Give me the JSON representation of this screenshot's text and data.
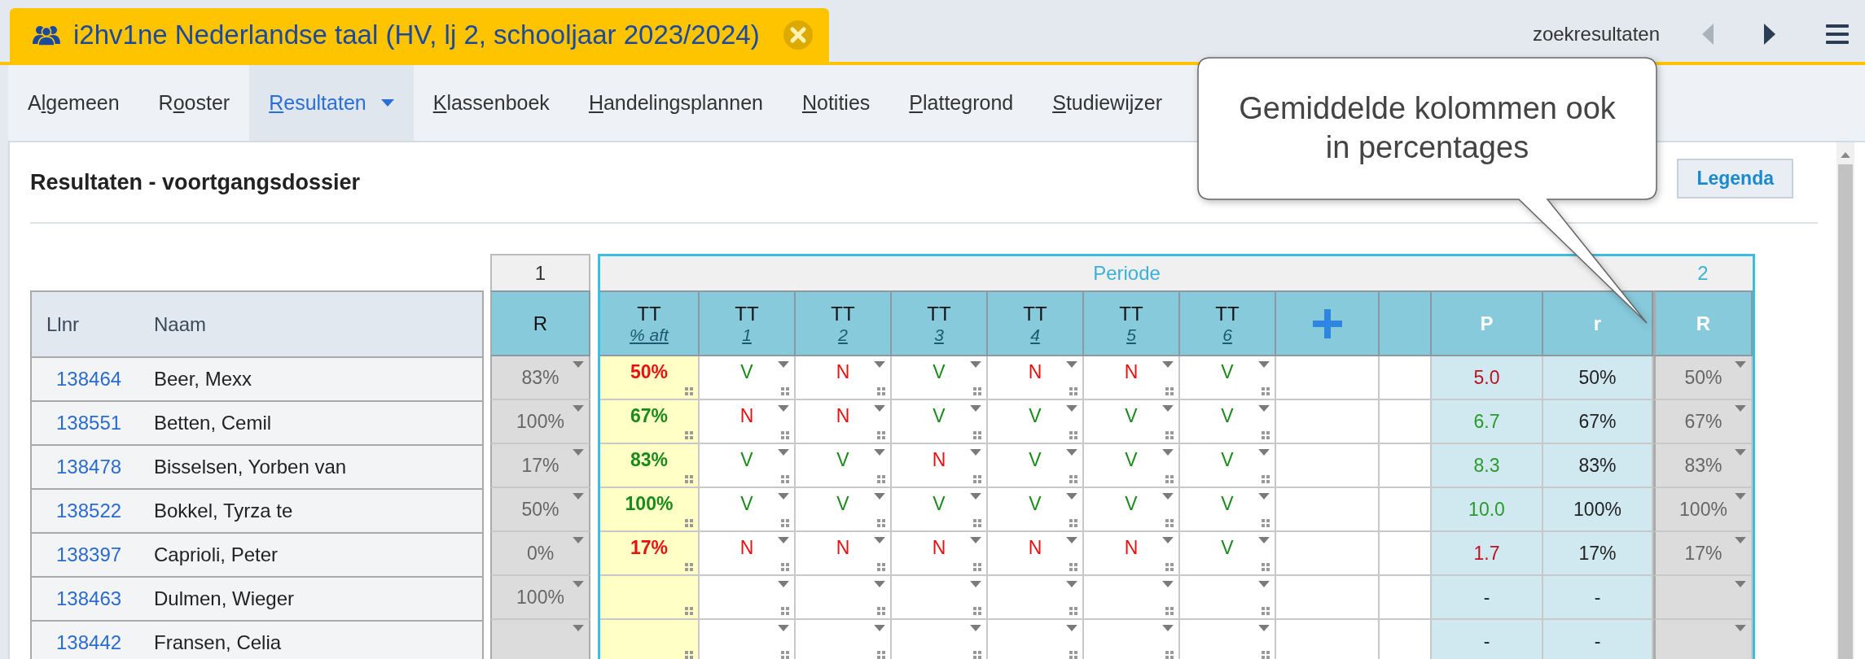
{
  "class_tab": {
    "title": "i2hv1ne Nederlandse taal (HV, lj 2, schooljaar 2023/2024)"
  },
  "search_nav": {
    "label": "zoekresultaten",
    "previous_disabled": true,
    "next_disabled": false
  },
  "nav_tabs": [
    {
      "label": {
        "before": "A",
        "key": "l",
        "after": "gemeen"
      },
      "selected": false,
      "has_menu": false
    },
    {
      "label": {
        "before": "R",
        "key": "o",
        "after": "oster"
      },
      "selected": false,
      "has_menu": false
    },
    {
      "label": {
        "key": "R",
        "after": "esultaten"
      },
      "selected": true,
      "has_menu": true
    },
    {
      "label": {
        "key": "K",
        "after": "lassenboek"
      },
      "selected": false,
      "has_menu": false
    },
    {
      "label": {
        "key": "H",
        "after": "andelingsplannen"
      },
      "selected": false,
      "has_menu": false
    },
    {
      "label": {
        "key": "N",
        "after": "otities"
      },
      "selected": false,
      "has_menu": false
    },
    {
      "label": {
        "key": "P",
        "after": "lattegrond"
      },
      "selected": false,
      "has_menu": false
    },
    {
      "label": {
        "key": "S",
        "after": "tudiewijzer"
      },
      "selected": false,
      "has_menu": false
    }
  ],
  "page_title": "Resultaten - voortgangsdossier",
  "legend_button": "Legenda",
  "callout": "Gemiddelde kolommen ook in percentages",
  "table": {
    "student_columns": [
      "Llnr",
      "Naam"
    ],
    "period1": {
      "number": "1",
      "column": "R"
    },
    "period": {
      "label": "Periode",
      "test_columns": [
        {
          "kind": "percentage",
          "type": "TT",
          "link": "% aft"
        },
        {
          "kind": "test",
          "type": "TT",
          "link": "1"
        },
        {
          "kind": "test",
          "type": "TT",
          "link": "2"
        },
        {
          "kind": "test",
          "type": "TT",
          "link": "3"
        },
        {
          "kind": "test",
          "type": "TT",
          "link": "4"
        },
        {
          "kind": "test",
          "type": "TT",
          "link": "5"
        },
        {
          "kind": "test",
          "type": "TT",
          "link": "6"
        }
      ],
      "average_columns": [
        "P",
        "r"
      ]
    },
    "period2": {
      "number": "2",
      "column": "R"
    },
    "rows": [
      {
        "llnr": "138464",
        "name": "Beer, Mexx",
        "r1": "83%",
        "pct": "50%",
        "passed": false,
        "marks": [
          {
            "text": "V",
            "passed": true
          },
          {
            "text": "N",
            "passed": false
          },
          {
            "text": "V",
            "passed": true
          },
          {
            "text": "N",
            "passed": false
          },
          {
            "text": "N",
            "passed": false
          },
          {
            "text": "V",
            "passed": true
          }
        ],
        "p": "5.0",
        "r": "50%",
        "r2": "50%"
      },
      {
        "llnr": "138551",
        "name": "Betten, Cemil",
        "r1": "100%",
        "pct": "67%",
        "passed": true,
        "marks": [
          {
            "text": "N",
            "passed": false
          },
          {
            "text": "N",
            "passed": false
          },
          {
            "text": "V",
            "passed": true
          },
          {
            "text": "V",
            "passed": true
          },
          {
            "text": "V",
            "passed": true
          },
          {
            "text": "V",
            "passed": true
          }
        ],
        "p": "6.7",
        "r": "67%",
        "r2": "67%"
      },
      {
        "llnr": "138478",
        "name": "Bisselsen, Yorben van",
        "r1": "17%",
        "pct": "83%",
        "passed": true,
        "marks": [
          {
            "text": "V",
            "passed": true
          },
          {
            "text": "V",
            "passed": true
          },
          {
            "text": "N",
            "passed": false
          },
          {
            "text": "V",
            "passed": true
          },
          {
            "text": "V",
            "passed": true
          },
          {
            "text": "V",
            "passed": true
          }
        ],
        "p": "8.3",
        "r": "83%",
        "r2": "83%"
      },
      {
        "llnr": "138522",
        "name": "Bokkel, Tyrza te",
        "r1": "50%",
        "pct": "100%",
        "passed": true,
        "marks": [
          {
            "text": "V",
            "passed": true
          },
          {
            "text": "V",
            "passed": true
          },
          {
            "text": "V",
            "passed": true
          },
          {
            "text": "V",
            "passed": true
          },
          {
            "text": "V",
            "passed": true
          },
          {
            "text": "V",
            "passed": true
          }
        ],
        "p": "10.0",
        "r": "100%",
        "r2": "100%"
      },
      {
        "llnr": "138397",
        "name": "Caprioli, Peter",
        "r1": "0%",
        "pct": "17%",
        "passed": false,
        "marks": [
          {
            "text": "N",
            "passed": false
          },
          {
            "text": "N",
            "passed": false
          },
          {
            "text": "N",
            "passed": false
          },
          {
            "text": "N",
            "passed": false
          },
          {
            "text": "N",
            "passed": false
          },
          {
            "text": "V",
            "passed": true
          }
        ],
        "p": "1.7",
        "r": "17%",
        "r2": "17%"
      },
      {
        "llnr": "138463",
        "name": "Dulmen, Wieger",
        "r1": "100%",
        "p": "-",
        "r": "-"
      },
      {
        "llnr": "138442",
        "name": "Fransen, Celia",
        "p": "-",
        "r": "-"
      }
    ]
  }
}
